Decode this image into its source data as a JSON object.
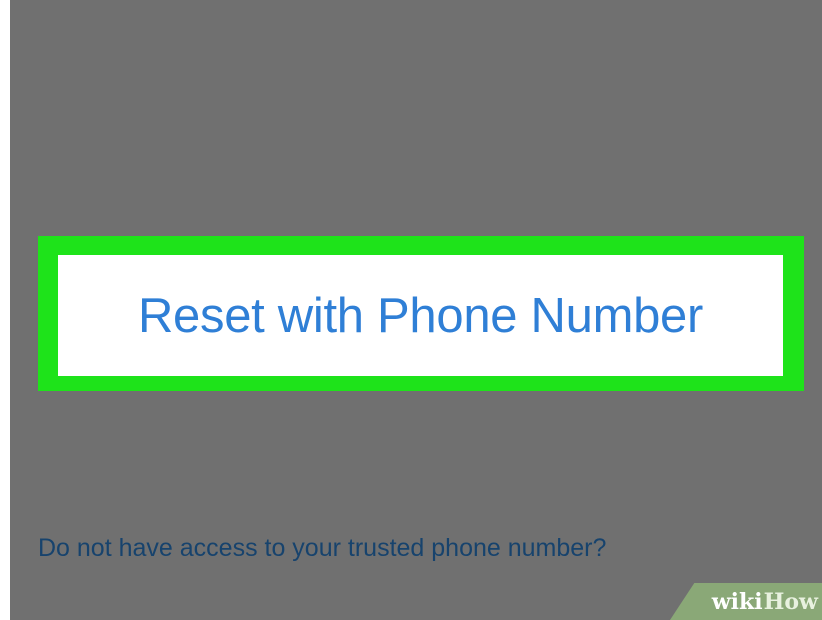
{
  "reset_option": {
    "label": "Reset with Phone Number"
  },
  "alternative": {
    "link_text": "Do not have access to your trusted phone number?"
  },
  "watermark": {
    "part1": "wiki",
    "part2": "How"
  },
  "colors": {
    "screen_background": "#707070",
    "highlight": "#1ee31a",
    "link_blue": "#2f7fd6",
    "dim_link": "#17436d"
  }
}
